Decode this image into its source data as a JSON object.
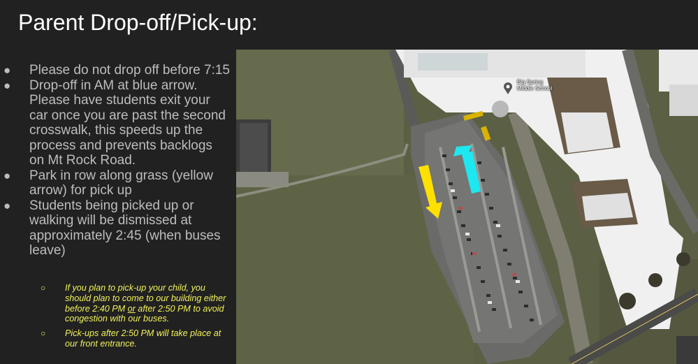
{
  "slide": {
    "title": "Parent Drop-off/Pick-up:",
    "bullets": [
      "Please do not drop off before 7:15",
      "Drop-off in AM at blue arrow. Please have students exit your car once you are past the second crosswalk, this speeds up the process and prevents backlogs on Mt Rock Road.",
      "Park in row along grass (yellow arrow) for pick up",
      "Students being picked up or walking will be dismissed at approximately 2:45 (when buses leave)"
    ],
    "sub_bullets": [
      {
        "before": "If you plan to pick-up your child, you should plan to come to our building either before 2:40 PM ",
        "emph": "or",
        "after": " after 2:50 PM to avoid congestion with our buses."
      },
      {
        "before": "Pick-ups after 2:50 PM will take place at our front entrance.",
        "emph": "",
        "after": ""
      }
    ],
    "bullet_glyph": "●",
    "sub_glyph": "○"
  },
  "map": {
    "place_label_line1": "Big Spring",
    "place_label_line2": "Middle School",
    "pin_icon": "map-pin-icon",
    "colors": {
      "background": "#212121",
      "title": "#ffffff",
      "bullet_text": "#bdbdbd",
      "sub_text": "#f2f25a",
      "blue_arrow": "#1de7ef",
      "yellow_arrow": "#ffe000",
      "grass": "#5d6145",
      "roof": "#f2f2f2"
    }
  }
}
